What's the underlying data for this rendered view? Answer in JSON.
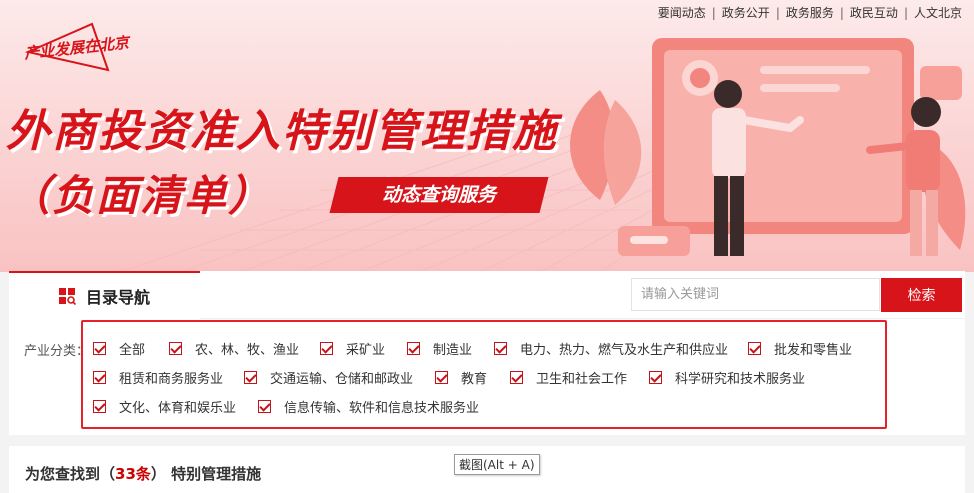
{
  "top_nav": [
    "要闻动态",
    "政务公开",
    "政务服务",
    "政民互动",
    "人文北京"
  ],
  "banner": {
    "logo": "产业发展在北京",
    "headline": "外商投资准入特别管理措施",
    "subline": "（负面清单）",
    "service_badge": "动态查询服务"
  },
  "catalog": {
    "tab_label": "目录导航",
    "search_placeholder": "请输入关键词",
    "search_button": "检索",
    "category_label": "产业分类",
    "options": [
      {
        "label": "全部",
        "checked": true
      },
      {
        "label": "农、林、牧、渔业",
        "checked": true
      },
      {
        "label": "采矿业",
        "checked": true
      },
      {
        "label": "制造业",
        "checked": true
      },
      {
        "label": "电力、热力、燃气及水生产和供应业",
        "checked": true
      },
      {
        "label": "批发和零售业",
        "checked": true
      },
      {
        "label": "租赁和商务服务业",
        "checked": true
      },
      {
        "label": "交通运输、仓储和邮政业",
        "checked": true
      },
      {
        "label": "教育",
        "checked": true
      },
      {
        "label": "卫生和社会工作",
        "checked": true
      },
      {
        "label": "科学研究和技术服务业",
        "checked": true
      },
      {
        "label": "文化、体育和娱乐业",
        "checked": true
      },
      {
        "label": "信息传输、软件和信息技术服务业",
        "checked": true
      }
    ]
  },
  "results": {
    "prefix": "为您查找到（",
    "count": "33条",
    "suffix": "） 特别管理措施"
  },
  "tooltip": "截图(Alt + A)",
  "colors": {
    "accent": "#d7141a",
    "filter_border": "#e8202a",
    "banner_bg": "#fbd3d3"
  }
}
